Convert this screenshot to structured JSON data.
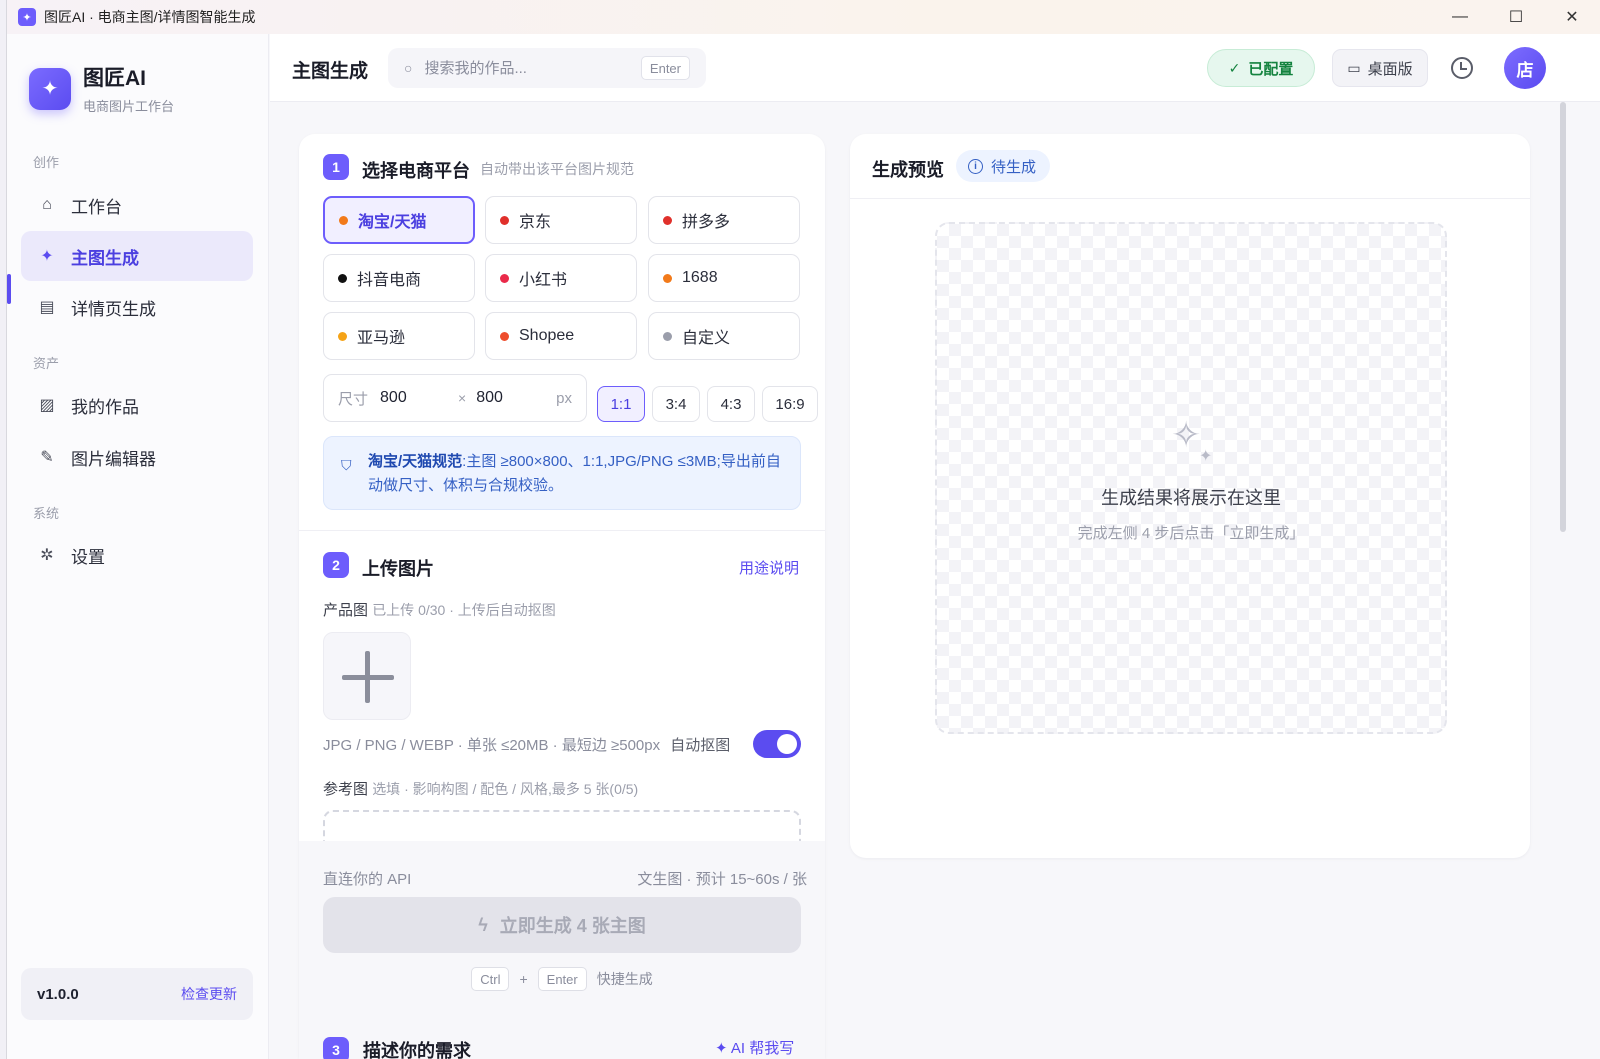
{
  "window": {
    "title": "图匠AI · 电商主图/详情图智能生成",
    "controls": [
      "—",
      "☐",
      "✕"
    ]
  },
  "sidebar": {
    "brand_name": "图匠AI",
    "brand_sub": "电商图片工作台",
    "sections": {
      "create": "创作",
      "assets": "资产",
      "system": "系统"
    },
    "items": [
      {
        "label": "工作台",
        "icon": "home-icon"
      },
      {
        "label": "主图生成",
        "icon": "sparkle-icon",
        "active": true
      },
      {
        "label": "详情页生成",
        "icon": "document-icon"
      },
      {
        "label": "我的作品",
        "icon": "image-icon"
      },
      {
        "label": "图片编辑器",
        "icon": "pencil-icon"
      },
      {
        "label": "设置",
        "icon": "gear-icon"
      }
    ],
    "version": "v1.0.0",
    "check_update": "检查更新"
  },
  "header": {
    "title": "主图生成",
    "search_placeholder": "搜索我的作品...",
    "search_shortcut": "Enter",
    "configured": "已配置",
    "desktop": "桌面版",
    "avatar": "店"
  },
  "step1": {
    "num": "1",
    "title": "选择电商平台",
    "hint": "自动带出该平台图片规范",
    "platforms": [
      {
        "label": "淘宝/天猫",
        "color": "#f27a1a",
        "active": true
      },
      {
        "label": "京东",
        "color": "#e0302b"
      },
      {
        "label": "拼多多",
        "color": "#e0302b"
      },
      {
        "label": "抖音电商",
        "color": "#111111"
      },
      {
        "label": "小红书",
        "color": "#ea2a4a"
      },
      {
        "label": "1688",
        "color": "#f27a1a"
      },
      {
        "label": "亚马逊",
        "color": "#f5a317"
      },
      {
        "label": "Shopee",
        "color": "#ee4d2d"
      },
      {
        "label": "自定义",
        "color": "#9b9eab"
      }
    ],
    "size_label": "尺寸",
    "width": "800",
    "height": "800",
    "times": "×",
    "unit": "px",
    "ratios": [
      {
        "label": "1:1",
        "active": true
      },
      {
        "label": "3:4"
      },
      {
        "label": "4:3"
      },
      {
        "label": "16:9"
      }
    ],
    "spec_name": "淘宝/天猫规范",
    "spec_text": ":主图 ≥800×800、1:1,JPG/PNG ≤3MB;导出前自动做尺寸、体积与合规校验。"
  },
  "step2": {
    "num": "2",
    "title": "上传图片",
    "help_link": "用途说明",
    "product_label": "产品图",
    "product_hint": "已上传 0/30 · 上传后自动抠图",
    "formats": "JPG / PNG / WEBP · 单张 ≤20MB · 最短边 ≥500px",
    "auto_cutout": "自动抠图",
    "auto_cutout_on": true,
    "reference_label": "参考图",
    "reference_hint": "选填 · 影响构图 / 配色 / 风格,最多 5 张(0/5)"
  },
  "footer": {
    "api": "直连你的 API",
    "estimate": "文生图 · 预计 15~60s / 张",
    "generate": "立即生成 4 张主图",
    "shortcut_ctrl": "Ctrl",
    "shortcut_plus": "+",
    "shortcut_enter": "Enter",
    "shortcut_text": "快捷生成"
  },
  "step3": {
    "num": "3",
    "title": "描述你的需求",
    "link": "✦ AI 帮我写"
  },
  "preview": {
    "title": "生成预览",
    "status": "待生成",
    "empty_title": "生成结果将展示在这里",
    "empty_sub": "完成左侧 4 步后点击「立即生成」"
  }
}
